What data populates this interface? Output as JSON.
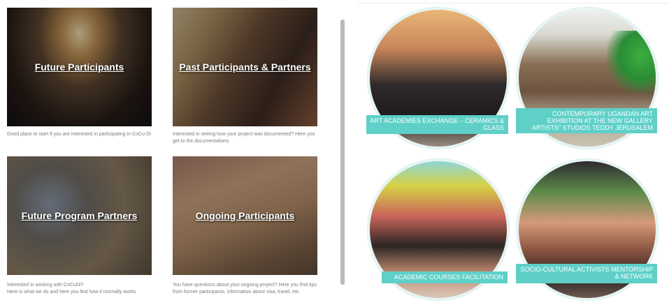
{
  "cards": [
    {
      "title": "Future Participants",
      "description": "Good place to start if you are interested in participating in CoCu-Di"
    },
    {
      "title": "Past Participants & Partners",
      "description": "Interested in seeing how your project was documented? Here you get to the documentations"
    },
    {
      "title": "Future Program Partners",
      "description": "Interested in working with CoCuDi?\nHere is what we do and here you find how it normally works"
    },
    {
      "title": "Ongoing Participants",
      "description": "You have questions about your ongoing project? Here you find tips from former participants, information about visa, travel, etc."
    }
  ],
  "projects": [
    {
      "label": "ART ACADEMIES EXCHANGE – Ceramics & Glass"
    },
    {
      "label": "CONTEMPORARY UGANDAN ART EXHIBITION AT the New Gallery Artists'' Studios Teddy Jerusalem"
    },
    {
      "label": "ACADEMIC COURSES FACILITATION"
    },
    {
      "label": "SOCIO-CULTURAL ACTIVISTS MENTORSHIP & NETWORK"
    }
  ],
  "colors": {
    "accent": "#5ed0c8",
    "description_text": "#7b7b7b"
  }
}
